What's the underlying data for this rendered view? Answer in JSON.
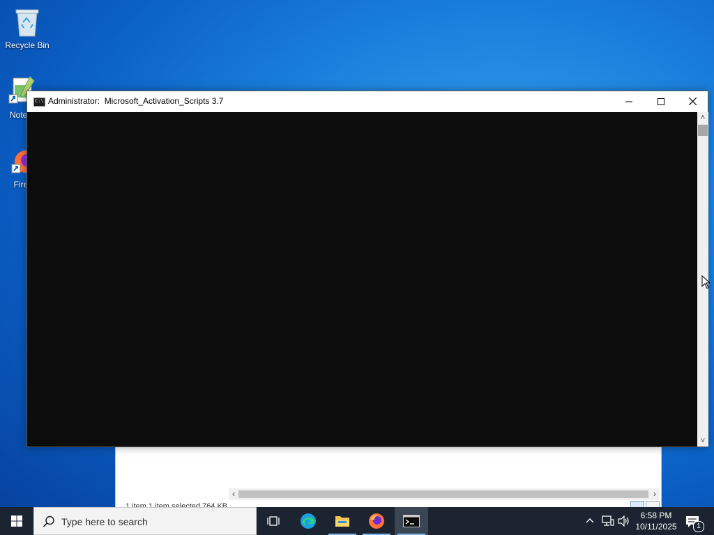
{
  "desktop": {
    "icons": [
      {
        "label": "Recycle Bin"
      },
      {
        "label": "Notep"
      },
      {
        "label": "Fire"
      }
    ]
  },
  "explorer": {
    "status_text": "1 item     1 item selected  764 KB"
  },
  "console": {
    "title": "Administrator:  Microsoft_Activation_Scripts 3.7",
    "minimize_label": "—",
    "maximize_label": "☐",
    "close_label": "✕"
  },
  "taskbar": {
    "search_placeholder": "Type here to search",
    "apps": [
      {
        "name": "task-view"
      },
      {
        "name": "edge"
      },
      {
        "name": "file-explorer"
      },
      {
        "name": "firefox"
      },
      {
        "name": "command-prompt",
        "active": true
      }
    ],
    "clock_time": "6:58 PM",
    "clock_date": "10/11/2025",
    "notification_count": "1"
  },
  "colors": {
    "taskbar_bg": "#1b2430",
    "console_bg": "#0c0c0c",
    "accent": "#0078d7"
  }
}
